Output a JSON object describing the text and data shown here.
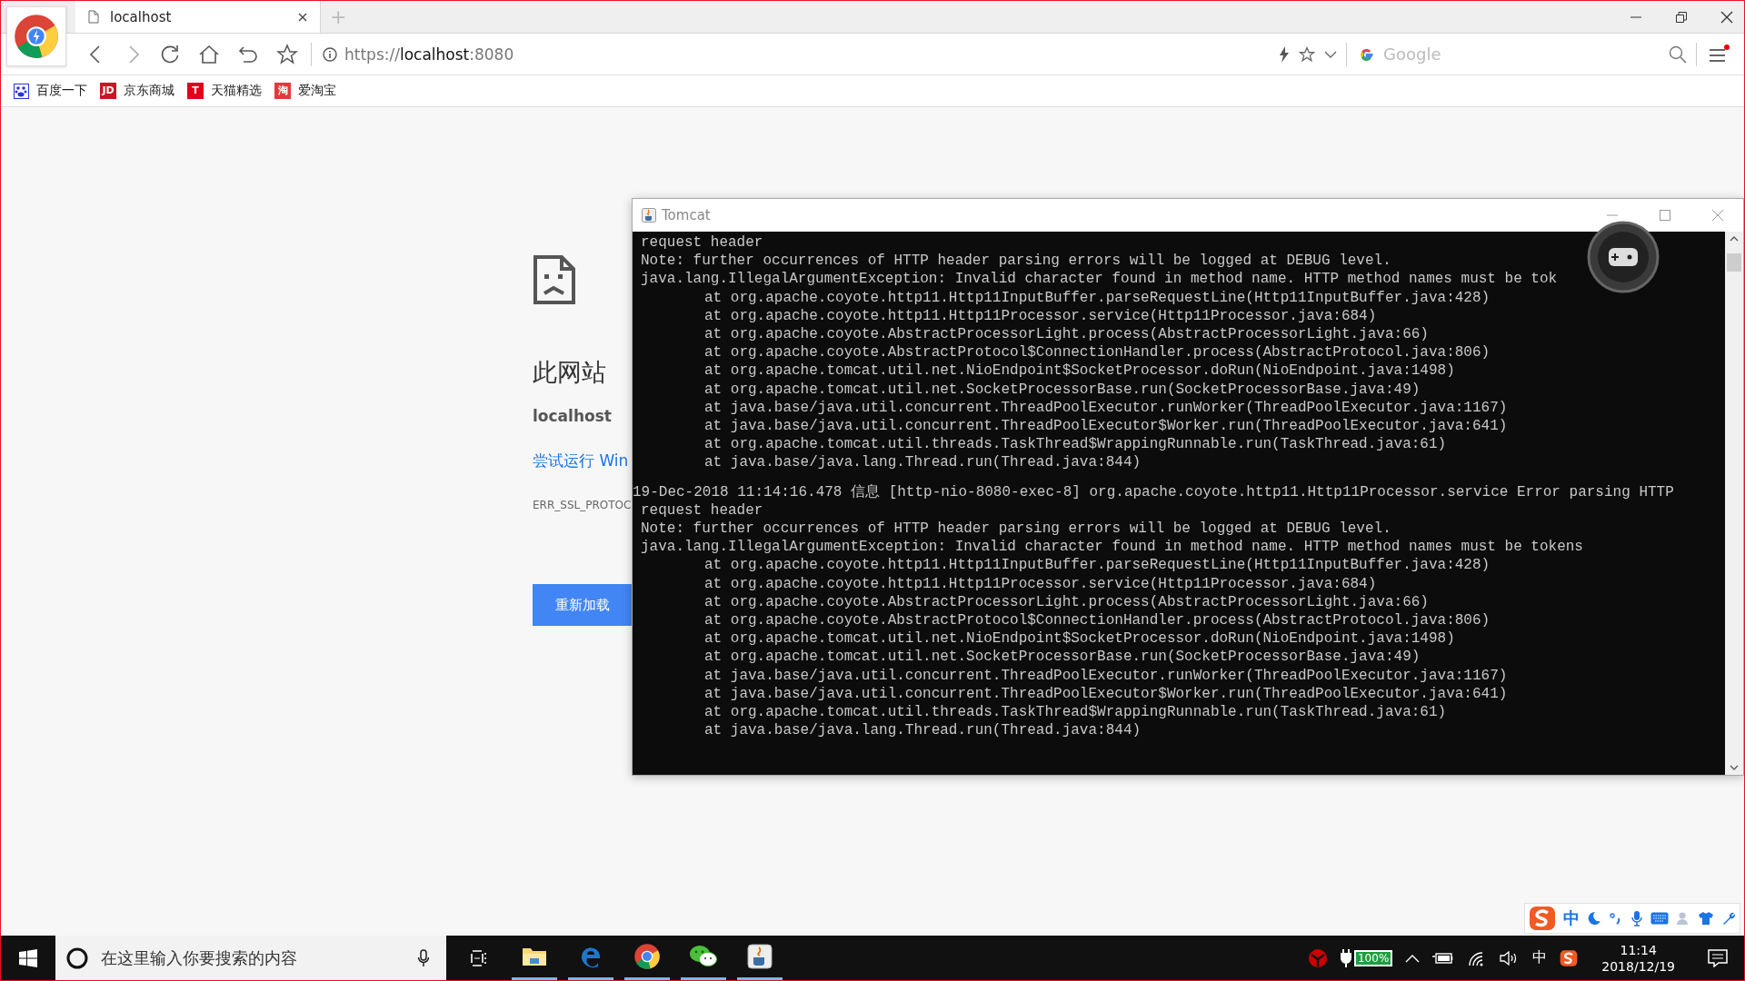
{
  "browser": {
    "tab": {
      "title": "localhost",
      "selected": true
    },
    "new_tab": "+",
    "address": {
      "scheme": "https://",
      "host": "localhost",
      "port": ":8080"
    },
    "search": {
      "placeholder": "Google"
    },
    "bookmarks": [
      {
        "label": "百度一下",
        "color": "#2932e1"
      },
      {
        "label": "京东商城",
        "badge": "JD",
        "color": "#c91623"
      },
      {
        "label": "天猫精选",
        "badge": "T",
        "color": "#e3001b"
      },
      {
        "label": "爱淘宝",
        "badge": "淘",
        "color": "#e4393c"
      }
    ]
  },
  "error_page": {
    "heading": "此网站",
    "host": "localhost",
    "link": "尝试运行 Win",
    "code": "ERR_SSL_PROTOC",
    "button": "重新加载"
  },
  "console": {
    "title": "Tomcat",
    "lines": [
      {
        "kind": "text",
        "text": "request header"
      },
      {
        "kind": "text",
        "text": "Note: further occurrences of HTTP header parsing errors will be logged at DEBUG level."
      },
      {
        "kind": "text",
        "text": "java.lang.IllegalArgumentException: Invalid character found in method name. HTTP method names must be tok"
      },
      {
        "kind": "stack",
        "text": "at org.apache.coyote.http11.Http11InputBuffer.parseRequestLine(Http11InputBuffer.java:428)"
      },
      {
        "kind": "stack",
        "text": "at org.apache.coyote.http11.Http11Processor.service(Http11Processor.java:684)"
      },
      {
        "kind": "stack",
        "text": "at org.apache.coyote.AbstractProcessorLight.process(AbstractProcessorLight.java:66)"
      },
      {
        "kind": "stack",
        "text": "at org.apache.coyote.AbstractProtocol$ConnectionHandler.process(AbstractProtocol.java:806)"
      },
      {
        "kind": "stack",
        "text": "at org.apache.tomcat.util.net.NioEndpoint$SocketProcessor.doRun(NioEndpoint.java:1498)"
      },
      {
        "kind": "stack",
        "text": "at org.apache.tomcat.util.net.SocketProcessorBase.run(SocketProcessorBase.java:49)"
      },
      {
        "kind": "stack",
        "text": "at java.base/java.util.concurrent.ThreadPoolExecutor.runWorker(ThreadPoolExecutor.java:1167)"
      },
      {
        "kind": "stack",
        "text": "at java.base/java.util.concurrent.ThreadPoolExecutor$Worker.run(ThreadPoolExecutor.java:641)"
      },
      {
        "kind": "stack",
        "text": "at org.apache.tomcat.util.threads.TaskThread$WrappingRunnable.run(TaskThread.java:61)"
      },
      {
        "kind": "stack",
        "text": "at java.base/java.lang.Thread.run(Thread.java:844)"
      },
      {
        "kind": "entry",
        "text": "19-Dec-2018 11:14:16.478 信息 [http-nio-8080-exec-8] org.apache.coyote.http11.Http11Processor.service Error parsing HTTP"
      },
      {
        "kind": "text",
        "text": "request header"
      },
      {
        "kind": "text",
        "text": "Note: further occurrences of HTTP header parsing errors will be logged at DEBUG level."
      },
      {
        "kind": "text",
        "text": "java.lang.IllegalArgumentException: Invalid character found in method name. HTTP method names must be tokens"
      },
      {
        "kind": "stack",
        "text": "at org.apache.coyote.http11.Http11InputBuffer.parseRequestLine(Http11InputBuffer.java:428)"
      },
      {
        "kind": "stack",
        "text": "at org.apache.coyote.http11.Http11Processor.service(Http11Processor.java:684)"
      },
      {
        "kind": "stack",
        "text": "at org.apache.coyote.AbstractProcessorLight.process(AbstractProcessorLight.java:66)"
      },
      {
        "kind": "stack",
        "text": "at org.apache.coyote.AbstractProtocol$ConnectionHandler.process(AbstractProtocol.java:806)"
      },
      {
        "kind": "stack",
        "text": "at org.apache.tomcat.util.net.NioEndpoint$SocketProcessor.doRun(NioEndpoint.java:1498)"
      },
      {
        "kind": "stack",
        "text": "at org.apache.tomcat.util.net.SocketProcessorBase.run(SocketProcessorBase.java:49)"
      },
      {
        "kind": "stack",
        "text": "at java.base/java.util.concurrent.ThreadPoolExecutor.runWorker(ThreadPoolExecutor.java:1167)"
      },
      {
        "kind": "stack",
        "text": "at java.base/java.util.concurrent.ThreadPoolExecutor$Worker.run(ThreadPoolExecutor.java:641)"
      },
      {
        "kind": "stack",
        "text": "at org.apache.tomcat.util.threads.TaskThread$WrappingRunnable.run(TaskThread.java:61)"
      },
      {
        "kind": "stack",
        "text": "at java.base/java.lang.Thread.run(Thread.java:844)"
      }
    ]
  },
  "ime_bar": {
    "mode": "中"
  },
  "taskbar": {
    "search": {
      "placeholder": "在这里输入你要搜索的内容"
    },
    "apps": [
      {
        "kind": "explorer",
        "running": true
      },
      {
        "kind": "edge",
        "running": true
      },
      {
        "kind": "chrome",
        "running": true
      },
      {
        "kind": "wechat",
        "running": true
      },
      {
        "kind": "java",
        "running": true
      }
    ],
    "battery": "100%",
    "input_mode": "中",
    "time": "11:14",
    "date": "2018/12/19"
  }
}
